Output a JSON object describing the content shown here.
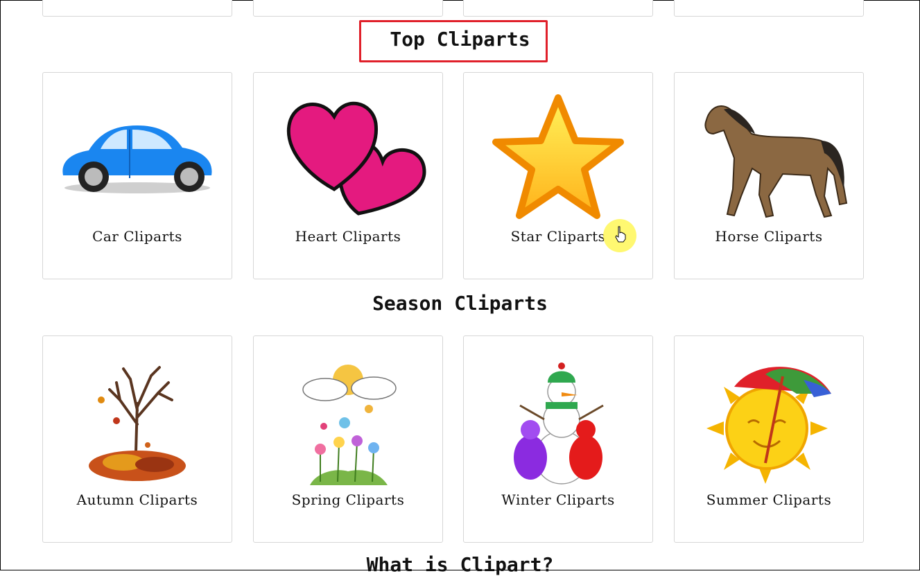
{
  "sections": {
    "top_title": "Top Cliparts",
    "season_title": "Season Cliparts",
    "next_title": "What is Clipart?"
  },
  "top_cliparts": [
    {
      "label": "Car Cliparts",
      "icon": "car-icon"
    },
    {
      "label": "Heart Cliparts",
      "icon": "hearts-icon"
    },
    {
      "label": "Star Cliparts",
      "icon": "star-icon"
    },
    {
      "label": "Horse Cliparts",
      "icon": "horse-icon"
    }
  ],
  "season_cliparts": [
    {
      "label": "Autumn Cliparts",
      "icon": "autumn-tree-icon"
    },
    {
      "label": "Spring Cliparts",
      "icon": "spring-flowers-icon"
    },
    {
      "label": "Winter Cliparts",
      "icon": "snowman-icon"
    },
    {
      "label": "Summer Cliparts",
      "icon": "sun-umbrella-icon"
    }
  ],
  "colors": {
    "highlight": "#e0202a",
    "card_border": "#d6d6d6",
    "cursor_highlight": "#fff758"
  }
}
